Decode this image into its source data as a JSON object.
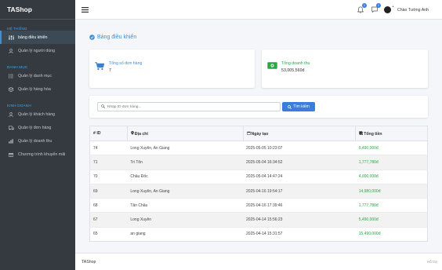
{
  "brand": "TAShop",
  "sidebar": {
    "sections": [
      {
        "title": "HỆ THỐNG",
        "items": [
          {
            "label": "bảng điều khiển",
            "icon": "sliders-icon",
            "active": true
          },
          {
            "label": "Quản lý người dùng",
            "icon": "user-icon"
          }
        ]
      },
      {
        "title": "DANH MỤC",
        "items": [
          {
            "label": "Quản lý danh mục",
            "icon": "list-icon"
          },
          {
            "label": "Quản lý hàng hóa",
            "icon": "box-icon"
          }
        ]
      },
      {
        "title": "KINH DOANH",
        "items": [
          {
            "label": "Quản lý khách hàng",
            "icon": "customer-icon"
          },
          {
            "label": "Quản lý đơn hàng",
            "icon": "truck-icon"
          },
          {
            "label": "Quản lý doanh thu",
            "icon": "bar-chart-icon"
          },
          {
            "label": "Chương trình khuyến mãi",
            "icon": "gift-icon"
          }
        ]
      }
    ]
  },
  "topbar": {
    "notification_count": "1",
    "message_count": "1",
    "user_greeting": "Chào Tường Anh"
  },
  "page_title": "Bảng điều khiển",
  "stats": {
    "orders_label": "Tổng số đơn hàng",
    "orders_value": "7",
    "revenue_label": "Tổng doanh thu",
    "revenue_value": "53,005,560đ"
  },
  "search": {
    "placeholder": "Nhập ID đơn hàng...",
    "button_label": "Tìm kiếm"
  },
  "table": {
    "headers": [
      "# ID",
      "Địa chỉ",
      "Ngày tạo",
      "Tổng tiền"
    ],
    "rows": [
      {
        "id": "74",
        "address": "Long Xuyên, An Giang",
        "date": "2025-05-05 10:23:07",
        "total": "9,490,000đ"
      },
      {
        "id": "71",
        "address": "Tri Tôn",
        "date": "2025-05-04 16:34:52",
        "total": "1,777,780đ"
      },
      {
        "id": "70",
        "address": "Châu Đốc",
        "date": "2025-05-04 14:47:24",
        "total": "4,000,000đ"
      },
      {
        "id": "69",
        "address": "Long Xuyên, An Giang",
        "date": "2025-04-16 19:54:17",
        "total": "14,980,000đ"
      },
      {
        "id": "68",
        "address": "Tân Châu",
        "date": "2025-04-16 17:39:46",
        "total": "1,777,780đ"
      },
      {
        "id": "67",
        "address": "Long Xuyên",
        "date": "2025-04-14 15:56:23",
        "total": "5,490,000đ"
      },
      {
        "id": "65",
        "address": "an giang",
        "date": "2025-04-14 15:31:57",
        "total": "15,490,000đ"
      }
    ]
  },
  "footer": {
    "left": "TAShop",
    "right": "Hỗ trợ"
  },
  "colors": {
    "sidebar_bg": "#343a40",
    "accent": "#3b8ed8",
    "money": "#28a745",
    "button": "#3b7ddd"
  }
}
